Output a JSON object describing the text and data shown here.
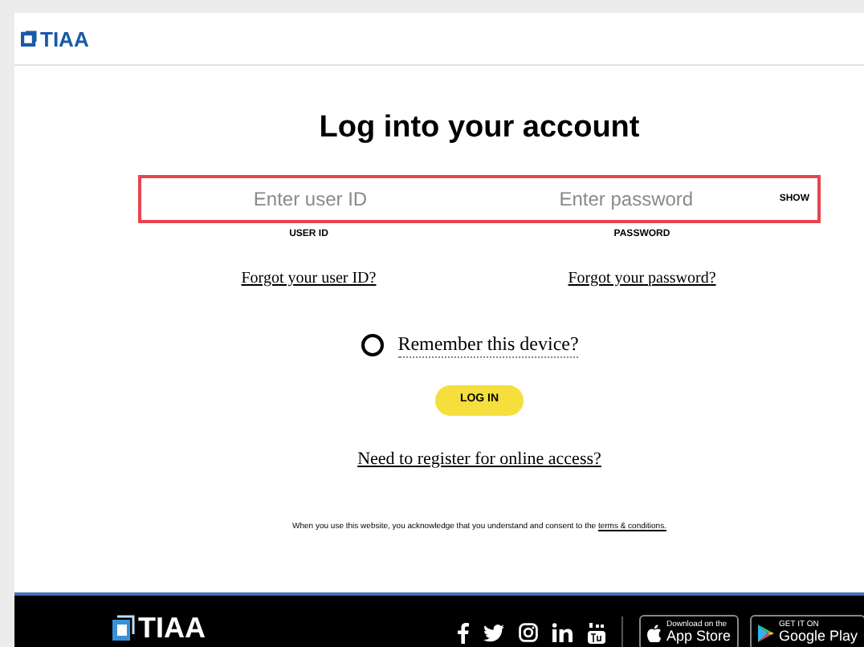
{
  "header": {
    "logo": "TIAA"
  },
  "title": "Log into your account",
  "fields": [
    {
      "placeholder": "Enter user ID",
      "label": "USER ID",
      "link": "Forgot your user ID?"
    },
    {
      "placeholder": "Enter password",
      "label": "PASSWORD",
      "link": "Forgot your password?",
      "toggle": "SHOW"
    }
  ],
  "remember": {
    "label": "Remember this device?",
    "checked": false
  },
  "login_button": "LOG IN",
  "register_link": "Need to register for online access?",
  "notice": {
    "text": "When you use this website, you acknowledge that you understand and consent to the ",
    "link": "terms & conditions."
  },
  "footer": {
    "logo": "TIAA",
    "badges": [
      {
        "small": "Download on the",
        "big": "App Store"
      },
      {
        "small": "GET IT ON",
        "big": "Google Play"
      }
    ]
  }
}
